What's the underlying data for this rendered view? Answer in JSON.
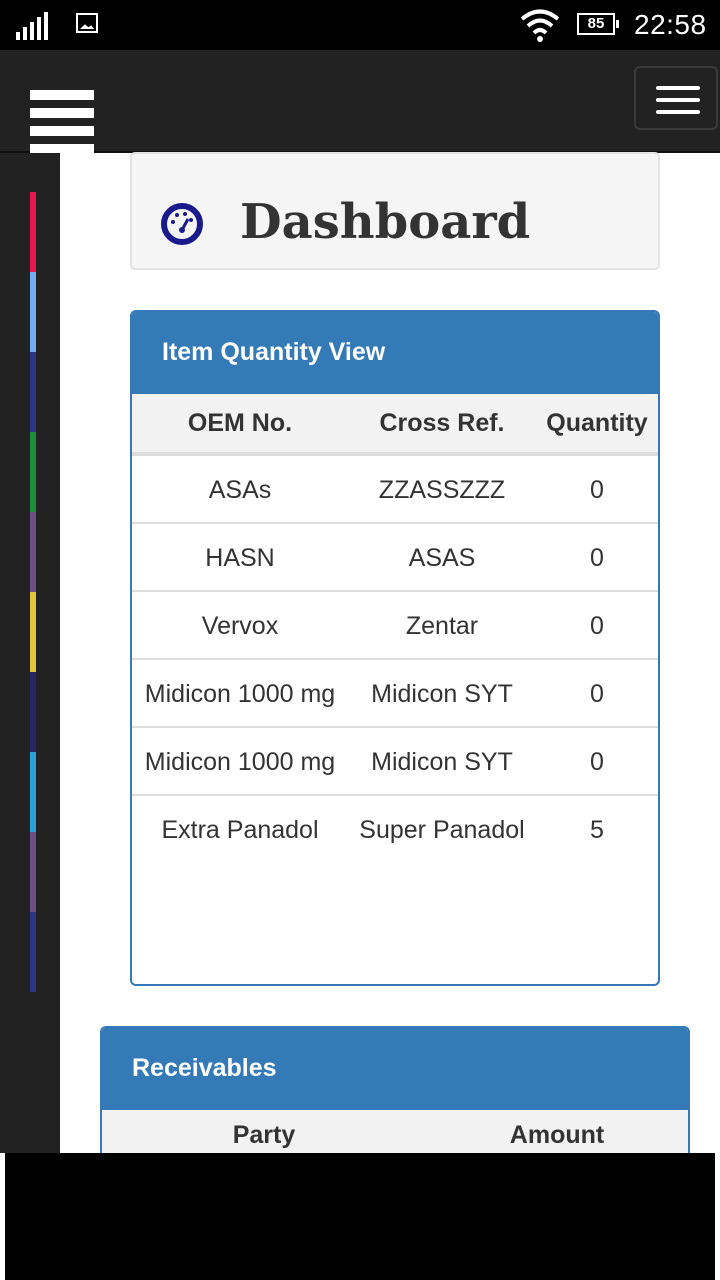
{
  "status_bar": {
    "battery": "85",
    "time": "22:58",
    "icons": [
      "signal-icon",
      "image-icon",
      "wifi-icon",
      "battery-icon"
    ]
  },
  "page": {
    "title": "Dashboard",
    "title_icon": "dashboard-gauge-icon"
  },
  "item_quantity": {
    "heading": "Item Quantity View",
    "columns": [
      "OEM No.",
      "Cross Ref.",
      "Quantity"
    ],
    "rows": [
      {
        "oem": "ASAs",
        "cross": "ZZASSZZZ",
        "qty": "0"
      },
      {
        "oem": "HASN",
        "cross": "ASAS",
        "qty": "0"
      },
      {
        "oem": "Vervox",
        "cross": "Zentar",
        "qty": "0"
      },
      {
        "oem": "Midicon 1000 mg",
        "cross": "Midicon SYT",
        "qty": "0"
      },
      {
        "oem": "Midicon 1000 mg",
        "cross": "Midicon SYT",
        "qty": "0"
      },
      {
        "oem": "Extra Panadol",
        "cross": "Super Panadol",
        "qty": "5"
      }
    ]
  },
  "receivables": {
    "heading": "Receivables",
    "columns": [
      "Party",
      "Amount"
    ]
  },
  "colors": {
    "primary": "#337ab7",
    "appbar": "#222222",
    "sidebar_strips": [
      "#e8174f",
      "#75aaf5",
      "#2d3584",
      "#1d8f3a",
      "#6b4f86",
      "#e3c53a",
      "#2a2564",
      "#2da0d8",
      "#6b4f86",
      "#2d3584"
    ]
  }
}
